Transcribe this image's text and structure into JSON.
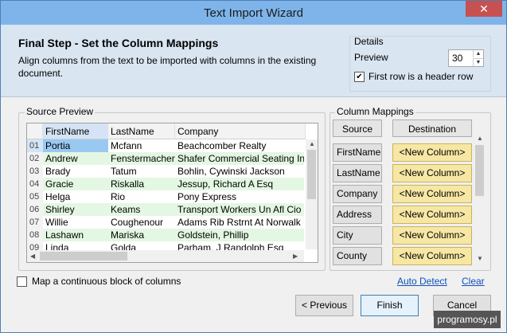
{
  "window": {
    "title": "Text Import Wizard",
    "close_glyph": "✕"
  },
  "header": {
    "title": "Final Step - Set the Column Mappings",
    "description": "Align columns from the text to be imported with columns in the existing document.",
    "details_label": "Details",
    "preview_label": "Preview",
    "preview_value": "30",
    "first_row_header_label": "First row is a header row",
    "first_row_header_checked": true
  },
  "source_preview": {
    "label": "Source Preview",
    "columns": [
      "FirstName",
      "LastName",
      "Company"
    ],
    "rows": [
      [
        "01",
        "Portia",
        "Mcfann",
        "Beachcomber Realty"
      ],
      [
        "02",
        "Andrew",
        "Fenstermacher",
        "Shafer Commercial Seating Inc"
      ],
      [
        "03",
        "Brady",
        "Tatum",
        "Bohlin, Cywinski Jackson"
      ],
      [
        "04",
        "Gracie",
        "Riskalla",
        "Jessup, Richard A Esq"
      ],
      [
        "05",
        "Helga",
        "Rio",
        "Pony Express"
      ],
      [
        "06",
        "Shirley",
        "Keams",
        "Transport Workers Un Afl Cio"
      ],
      [
        "07",
        "Willie",
        "Coughenour",
        "Adams Rib Rstrnt At Norwalk"
      ],
      [
        "08",
        "Lashawn",
        "Mariska",
        "Goldstein, Phillip"
      ],
      [
        "09",
        "Linda",
        "Golda",
        "Parham, J Randolph Esq"
      ]
    ]
  },
  "column_mappings": {
    "label": "Column Mappings",
    "source_header": "Source",
    "destination_header": "Destination",
    "items": [
      {
        "source": "FirstName",
        "destination": "<New Column>"
      },
      {
        "source": "LastName",
        "destination": "<New Column>"
      },
      {
        "source": "Company",
        "destination": "<New Column>"
      },
      {
        "source": "Address",
        "destination": "<New Column>"
      },
      {
        "source": "City",
        "destination": "<New Column>"
      },
      {
        "source": "County",
        "destination": "<New Column>"
      }
    ]
  },
  "footer": {
    "map_block_label": "Map a continuous block of columns",
    "map_block_checked": false,
    "auto_detect": "Auto Detect",
    "clear": "Clear",
    "previous": "< Previous",
    "finish": "Finish",
    "cancel": "Cancel"
  },
  "watermark": "programosy.pl"
}
